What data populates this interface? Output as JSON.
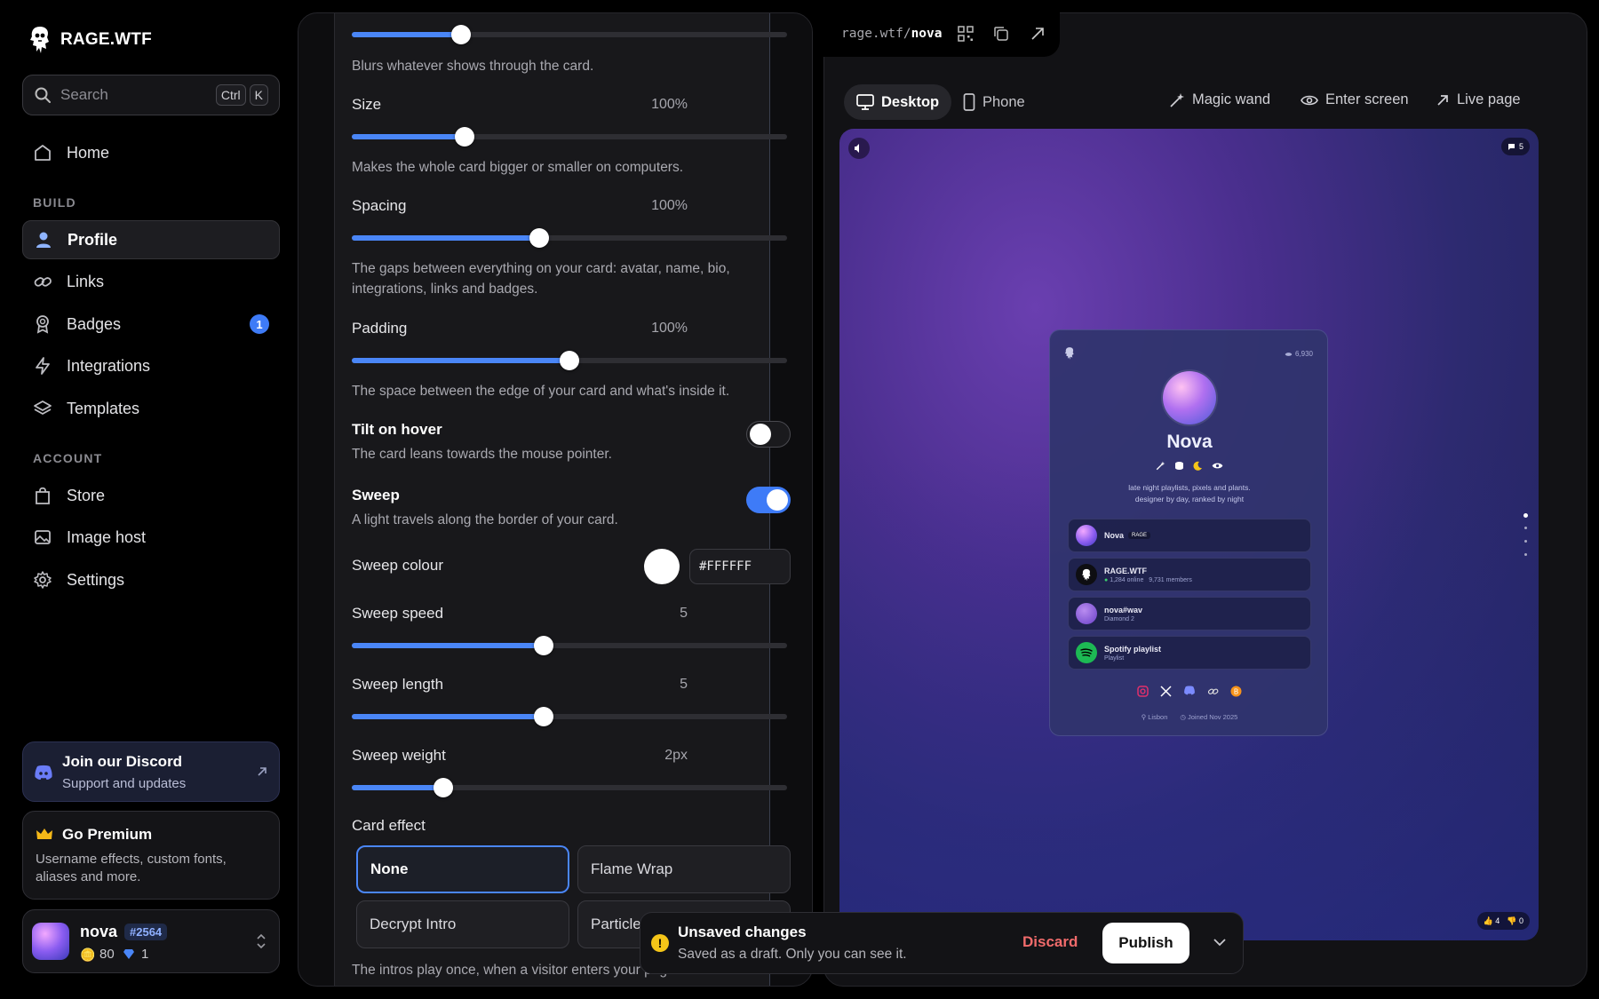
{
  "app": {
    "name": "RAGE.WTF"
  },
  "search": {
    "placeholder": "Search",
    "kbd1": "Ctrl",
    "kbd2": "K"
  },
  "nav": {
    "home": "Home",
    "build_label": "BUILD",
    "profile": "Profile",
    "links": "Links",
    "badges": "Badges",
    "badges_count": "1",
    "integrations": "Integrations",
    "templates": "Templates",
    "account_label": "ACCOUNT",
    "store": "Store",
    "image_host": "Image host",
    "settings": "Settings"
  },
  "discord": {
    "title": "Join our Discord",
    "subtitle": "Support and updates"
  },
  "premium": {
    "title": "Go Premium",
    "subtitle": "Username effects, custom fonts, aliases and more."
  },
  "user": {
    "name": "nova",
    "tag": "#2564",
    "coins": "80",
    "gems": "1"
  },
  "editor": {
    "blur_desc": "Blurs whatever shows through the card.",
    "blur_level": 0.25,
    "size": {
      "title": "Size",
      "value": "100%",
      "desc": "Makes the whole card bigger or smaller on computers.",
      "level": 0.26
    },
    "spacing": {
      "title": "Spacing",
      "value": "100%",
      "desc": "The gaps between everything on your card: avatar, name, bio, integrations, links and badges.",
      "level": 0.43
    },
    "padding": {
      "title": "Padding",
      "value": "100%",
      "desc": "The space between the edge of your card and what's inside it.",
      "level": 0.5
    },
    "tilt": {
      "title": "Tilt on hover",
      "desc": "The card leans towards the mouse pointer.",
      "on": false
    },
    "sweep": {
      "title": "Sweep",
      "desc": "A light travels along the border of your card.",
      "on": true
    },
    "sweep_colour": {
      "title": "Sweep colour",
      "hex": "#FFFFFF",
      "color": "#FFFFFF"
    },
    "sweep_speed": {
      "title": "Sweep speed",
      "value": "5",
      "level": 0.44
    },
    "sweep_length": {
      "title": "Sweep length",
      "value": "5",
      "level": 0.44
    },
    "sweep_weight": {
      "title": "Sweep weight",
      "value": "2px",
      "level": 0.21
    },
    "card_effect": {
      "title": "Card effect",
      "options": [
        "None",
        "Flame Wrap",
        "Decrypt Intro",
        "Particle"
      ],
      "selected": "None",
      "desc": "The intros play once, when a visitor enters your page."
    }
  },
  "preview": {
    "url_prefix": "rage.wtf/",
    "url_user": "nova",
    "tabs": {
      "desktop": "Desktop",
      "phone": "Phone"
    },
    "actions": {
      "magic": "Magic wand",
      "enter": "Enter screen",
      "live": "Live page"
    },
    "card": {
      "views": "6,930",
      "name": "Nova",
      "bio_line1": "late night playlists, pixels and plants.",
      "bio_line2": "designer by day, ranked by night",
      "rows": [
        {
          "title": "Nova",
          "tag": "RAGE",
          "sub": ""
        },
        {
          "title": "RAGE.WTF",
          "sub": "1,284 online",
          "sub2": "9,731 members"
        },
        {
          "title": "nova#wav",
          "sub": "Diamond 2"
        },
        {
          "title": "Spotify playlist",
          "sub": "Playlist"
        }
      ],
      "location": "Lisbon",
      "joined": "Joined Nov 2025"
    },
    "comments": "5",
    "likes": "4",
    "dislikes": "0"
  },
  "unsaved": {
    "title": "Unsaved changes",
    "subtitle": "Saved as a draft. Only you can see it.",
    "discard": "Discard",
    "publish": "Publish"
  },
  "colors": {
    "accent": "#4A86F7",
    "discard": "#F06B6B",
    "warning": "#F5C518"
  }
}
